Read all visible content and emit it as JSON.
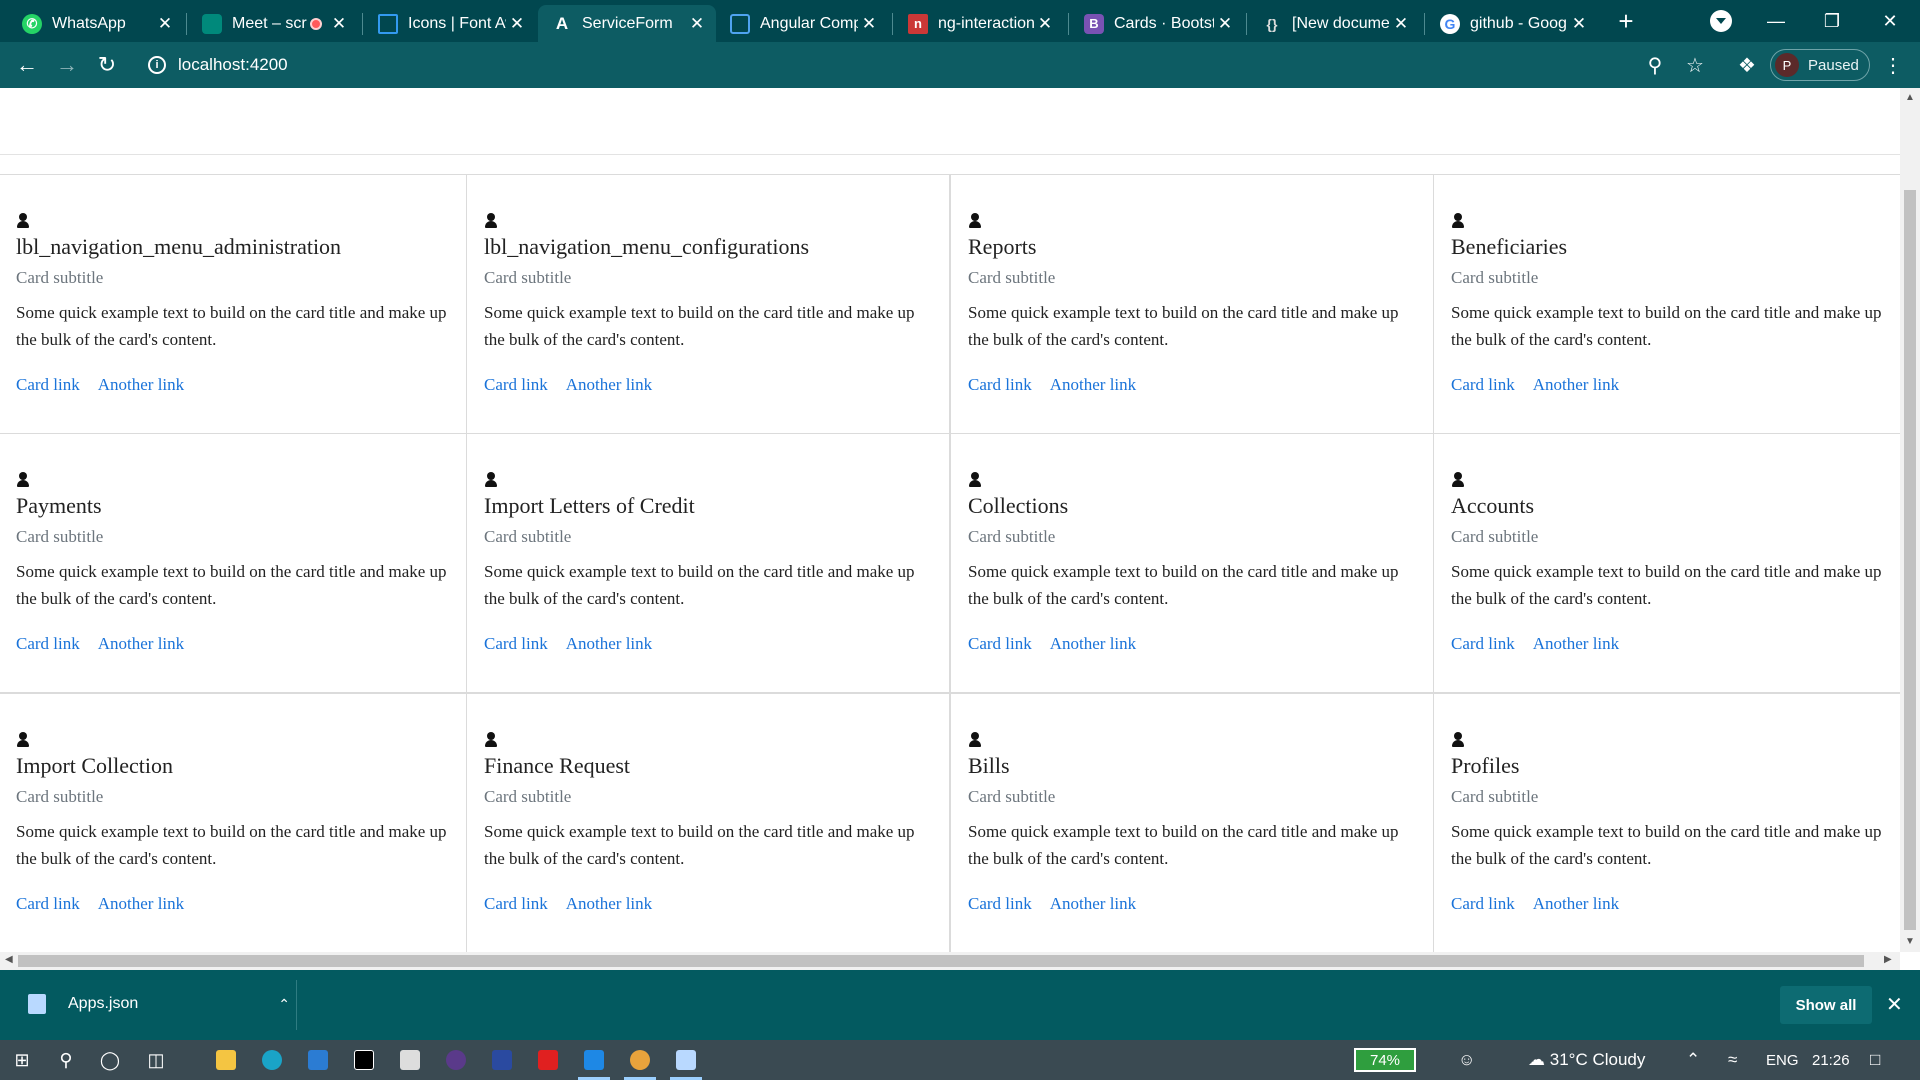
{
  "browser": {
    "tabs": [
      {
        "title": "WhatsApp",
        "icon": "whatsapp-icon",
        "color": "#25d366"
      },
      {
        "title": "Meet – scr",
        "icon": "google-meet-icon",
        "color": "#00897b"
      },
      {
        "title": "Icons | Font Aw",
        "icon": "font-awesome-flag-icon",
        "color": "#339af0"
      },
      {
        "title": "ServiceForm",
        "icon": "angular-icon",
        "color": "#ffffff"
      },
      {
        "title": "Angular Comp",
        "icon": "angular-material-icon",
        "color": "#1976d2"
      },
      {
        "title": "ng-interaction",
        "icon": "npm-icon",
        "color": "#cb3837"
      },
      {
        "title": "Cards · Bootstr",
        "icon": "bootstrap-icon",
        "color": "#7952b3"
      },
      {
        "title": "[New documen",
        "icon": "json-braces-icon",
        "color": "#cccccc"
      },
      {
        "title": "github - Goog",
        "icon": "google-icon",
        "color": "#ffffff"
      }
    ],
    "address": "localhost:4200",
    "profile_initial": "P",
    "profile_status": "Paused",
    "theme_color": "#0d5c63"
  },
  "cards": [
    {
      "title": "lbl_navigation_menu_administration",
      "subtitle": "Card subtitle",
      "text": "Some quick example text to build on the card title and make up the bulk of the card's content.",
      "link1": "Card link",
      "link2": "Another link"
    },
    {
      "title": "lbl_navigation_menu_configurations",
      "subtitle": "Card subtitle",
      "text": "Some quick example text to build on the card title and make up the bulk of the card's content.",
      "link1": "Card link",
      "link2": "Another link"
    },
    {
      "title": "Reports",
      "subtitle": "Card subtitle",
      "text": "Some quick example text to build on the card title and make up the bulk of the card's content.",
      "link1": "Card link",
      "link2": "Another link"
    },
    {
      "title": "Beneficiaries",
      "subtitle": "Card subtitle",
      "text": "Some quick example text to build on the card title and make up the bulk of the card's content.",
      "link1": "Card link",
      "link2": "Another link"
    },
    {
      "title": "Payments",
      "subtitle": "Card subtitle",
      "text": "Some quick example text to build on the card title and make up the bulk of the card's content.",
      "link1": "Card link",
      "link2": "Another link"
    },
    {
      "title": "Import Letters of Credit",
      "subtitle": "Card subtitle",
      "text": "Some quick example text to build on the card title and make up the bulk of the card's content.",
      "link1": "Card link",
      "link2": "Another link"
    },
    {
      "title": "Collections",
      "subtitle": "Card subtitle",
      "text": "Some quick example text to build on the card title and make up the bulk of the card's content.",
      "link1": "Card link",
      "link2": "Another link"
    },
    {
      "title": "Accounts",
      "subtitle": "Card subtitle",
      "text": "Some quick example text to build on the card title and make up the bulk of the card's content.",
      "link1": "Card link",
      "link2": "Another link"
    },
    {
      "title": "Import Collection",
      "subtitle": "Card subtitle",
      "text": "Some quick example text to build on the card title and make up the bulk of the card's content.",
      "link1": "Card link",
      "link2": "Another link"
    },
    {
      "title": "Finance Request",
      "subtitle": "Card subtitle",
      "text": "Some quick example text to build on the card title and make up the bulk of the card's content.",
      "link1": "Card link",
      "link2": "Another link"
    },
    {
      "title": "Bills",
      "subtitle": "Card subtitle",
      "text": "Some quick example text to build on the card title and make up the bulk of the card's content.",
      "link1": "Card link",
      "link2": "Another link"
    },
    {
      "title": "Profiles",
      "subtitle": "Card subtitle",
      "text": "Some quick example text to build on the card title and make up the bulk of the card's content.",
      "link1": "Card link",
      "link2": "Another link"
    }
  ],
  "downloads": {
    "file_name": "Apps.json",
    "show_all_label": "Show all"
  },
  "taskbar": {
    "battery": "74%",
    "weather": "31°C  Cloudy",
    "language": "ENG",
    "time": "21:26"
  }
}
